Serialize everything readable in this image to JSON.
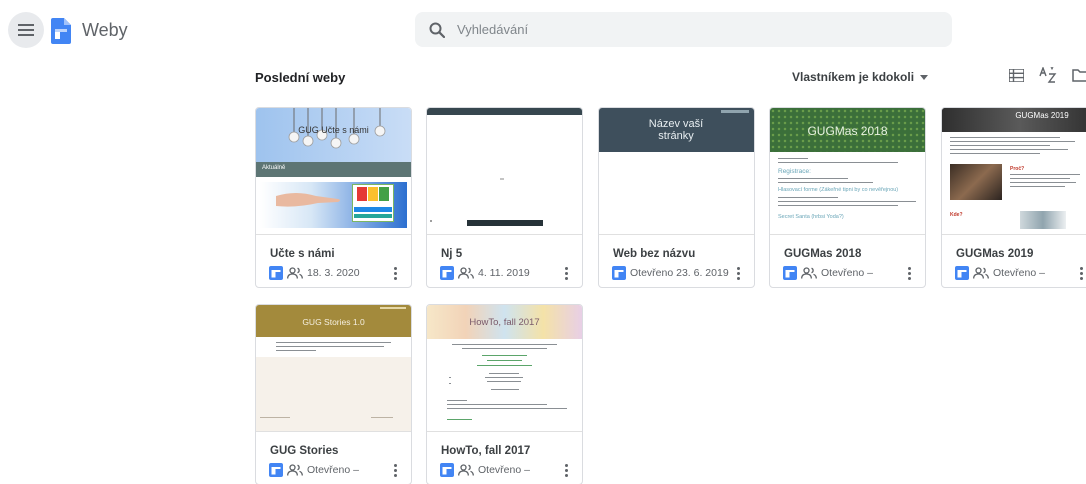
{
  "app": {
    "name": "Weby",
    "brand_color": "#4285f4"
  },
  "search": {
    "placeholder": "Vyhledávání"
  },
  "toolbar": {
    "section_title": "Poslední weby",
    "owner_filter": "Vlastníkem je kdokoli",
    "icons": [
      "list-view-icon",
      "sort-az-icon",
      "folder-icon"
    ]
  },
  "sites": [
    {
      "title": "Učte s námi",
      "date": "18. 3. 2020",
      "shared": true,
      "thumb": {
        "banner": "GUG Učte s námi",
        "nav": "Aktuálně"
      }
    },
    {
      "title": "Nj 5",
      "date": "4. 11. 2019",
      "shared": true,
      "thumb": {}
    },
    {
      "title": "Web bez názvu",
      "date": "Otevřeno 23. 6. 2019",
      "shared": false,
      "thumb": {
        "banner": "Název vaší stránky"
      }
    },
    {
      "title": "GUGMas 2018",
      "date": "Otevřeno –",
      "shared": true,
      "thumb": {
        "banner": "GUGMas 2018",
        "heading1": "Registrace:",
        "heading2": "Hlasovací forme (Zákeřné tipni by co nevěřejnou)",
        "heading3": "Secret Santa (hrbsi Yoda?)"
      }
    },
    {
      "title": "GUGMas 2019",
      "date": "Otevřeno –",
      "shared": true,
      "thumb": {
        "banner": "GUGMas 2019",
        "label1": "Proč?",
        "label2": "Kde?"
      }
    },
    {
      "title": "GUG Stories",
      "date": "Otevřeno –",
      "shared": true,
      "thumb": {
        "banner": "GUG Stories 1.0"
      }
    },
    {
      "title": "HowTo, fall 2017",
      "date": "Otevřeno –",
      "shared": true,
      "thumb": {
        "banner": "HowTo, fall 2017"
      }
    }
  ]
}
